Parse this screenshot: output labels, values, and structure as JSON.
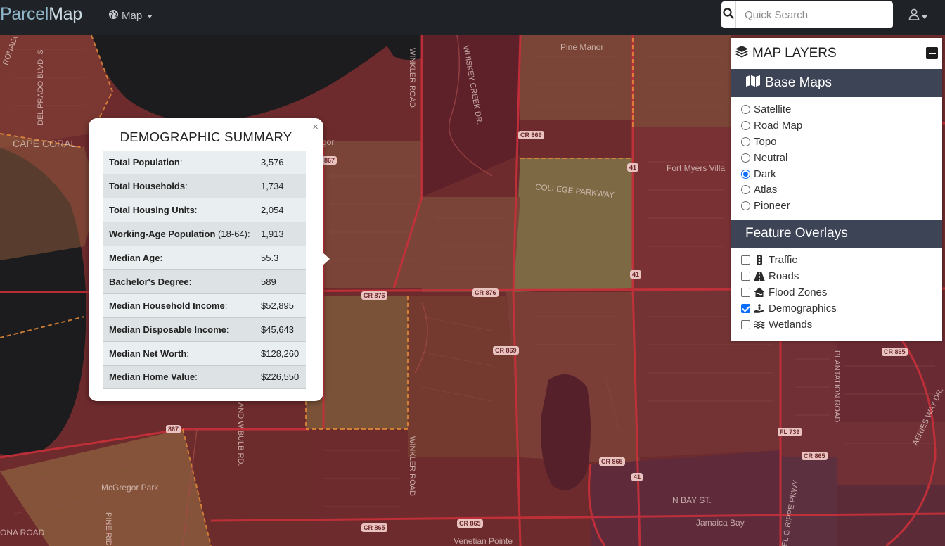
{
  "navbar": {
    "brand_part1": "Parcel",
    "brand_part2": "Map",
    "map_menu_label": "Map",
    "search_placeholder": "Quick Search",
    "icons": {
      "map_menu": "globe-icon",
      "search": "search-icon",
      "user": "user-icon"
    }
  },
  "map": {
    "labels": {
      "cape_coral": "CAPE CORAL",
      "del_prado": "DEL PRADO BLVD. S",
      "coronado": "RONADO",
      "winkler_top": "WINKLER ROAD",
      "whiskey_creek": "WHISKEY CREEK DR.",
      "pine_manor": "Pine Manor",
      "fort_myers_villas": "Fort Myers Villa",
      "college_parkway": "COLLEGE PARKWAY",
      "mcgregor_park": "McGregor Park",
      "winkler_bottom": "WINKLER ROAD",
      "bulb_rd": "AND W BULB RD.",
      "pine_ridge": "PINE RID",
      "ona_road": "ONA ROAD",
      "n_bay_st": "N BAY ST.",
      "jamaica_bay": "Jamaica Bay",
      "venetian_pointe": "Venetian Pointe",
      "plantation_road": "PLANTATION ROAD",
      "aeries_way": "AERIES WAY DR.",
      "ripple_pkwy": "EL G RIPPE PKWY",
      "gor": "gor"
    },
    "shields": {
      "cr869_top": "CR 869",
      "s867_top": "867",
      "s41_top": "41",
      "s41_mid": "41",
      "cr876_left": "CR 876",
      "cr876_mid": "CR 876",
      "cr869_mid": "CR 869",
      "cr865_right": "CR 865",
      "fl739": "FL 739",
      "cr865_r2": "CR 865",
      "cr865_mid": "CR 865",
      "s41_bottom": "41",
      "s867_bottom": "867",
      "cr865_b1": "CR 865",
      "cr865_b2": "CR 865"
    }
  },
  "popup": {
    "title": "DEMOGRAPHIC SUMMARY",
    "close_glyph": "×",
    "rows": [
      {
        "label": "Total Population",
        "suffix": ":",
        "value": "3,576"
      },
      {
        "label": "Total Households",
        "suffix": ":",
        "value": "1,734"
      },
      {
        "label": "Total Housing Units",
        "suffix": ":",
        "value": "2,054"
      },
      {
        "label": "Working-Age Population",
        "suffix": " (18-64):",
        "value": "1,913"
      },
      {
        "label": "Median Age",
        "suffix": ":",
        "value": "55.3"
      },
      {
        "label": "Bachelor's Degree",
        "suffix": ":",
        "value": "589"
      },
      {
        "label": "Median Household Income",
        "suffix": ":",
        "value": "$52,895"
      },
      {
        "label": "Median Disposable Income",
        "suffix": ":",
        "value": "$45,643"
      },
      {
        "label": "Median Net Worth",
        "suffix": ":",
        "value": "$128,260"
      },
      {
        "label": "Median Home Value",
        "suffix": ":",
        "value": "$226,550"
      }
    ]
  },
  "layers": {
    "title": "MAP LAYERS",
    "title_icon": "layers-icon",
    "base_maps": {
      "title": "Base Maps",
      "icon": "map-icon",
      "selected": "Dark",
      "options": [
        "Satellite",
        "Road Map",
        "Topo",
        "Neutral",
        "Dark",
        "Atlas",
        "Pioneer"
      ]
    },
    "feature_overlays": {
      "title": "Feature Overlays",
      "options": [
        {
          "label": "Traffic",
          "checked": false,
          "icon": "traffic-light-icon"
        },
        {
          "label": "Roads",
          "checked": false,
          "icon": "road-icon"
        },
        {
          "label": "Flood Zones",
          "checked": false,
          "icon": "house-flood-icon"
        },
        {
          "label": "Demographics",
          "checked": true,
          "icon": "people-hand-icon"
        },
        {
          "label": "Wetlands",
          "checked": false,
          "icon": "water-icon"
        }
      ]
    }
  }
}
